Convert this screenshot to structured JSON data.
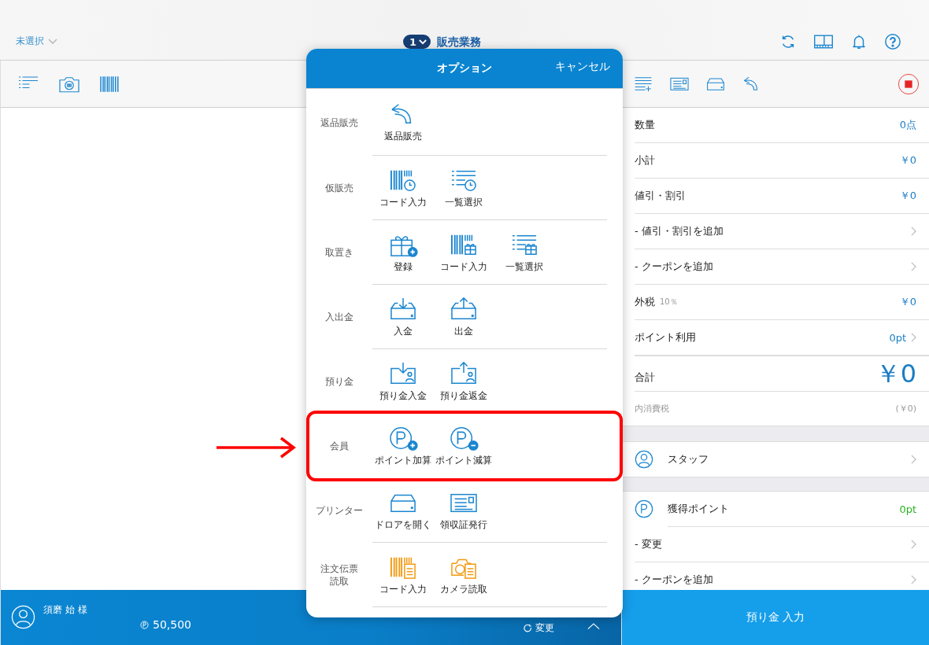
{
  "top_bar": {
    "store_select": "未選択",
    "register_number": "1",
    "title": "販売業務"
  },
  "customer_bar": {
    "name": "須磨 始 様",
    "points": "50,500",
    "change": "変更"
  },
  "options_dialog": {
    "title": "オプション",
    "cancel": "キャンセル",
    "sections": [
      {
        "label_lines": [
          "返品販売"
        ],
        "highlighted": false,
        "items": [
          "返品販売"
        ]
      },
      {
        "label_lines": [
          "仮販売"
        ],
        "highlighted": false,
        "items": [
          "コード入力",
          "一覧選択"
        ]
      },
      {
        "label_lines": [
          "取置き"
        ],
        "highlighted": false,
        "items": [
          "登録",
          "コード入力",
          "一覧選択"
        ]
      },
      {
        "label_lines": [
          "入出金"
        ],
        "highlighted": false,
        "items": [
          "入金",
          "出金"
        ]
      },
      {
        "label_lines": [
          "預り金"
        ],
        "highlighted": false,
        "items": [
          "預り金入金",
          "預り金返金"
        ]
      },
      {
        "label_lines": [
          "会員"
        ],
        "highlighted": true,
        "items": [
          "ポイント加算",
          "ポイント減算"
        ]
      },
      {
        "label_lines": [
          "プリンター"
        ],
        "highlighted": false,
        "items": [
          "ドロアを開く",
          "領収証発行"
        ]
      },
      {
        "label_lines": [
          "注文伝票",
          "読取"
        ],
        "highlighted": false,
        "items": [
          "コード入力",
          "カメラ読取"
        ]
      }
    ]
  },
  "summary": {
    "rows": [
      {
        "kind": "value",
        "label": "数量",
        "value": "0点"
      },
      {
        "kind": "value",
        "label": "小計",
        "value": "￥0"
      },
      {
        "kind": "value",
        "label": "値引・割引",
        "value": "￥0"
      },
      {
        "kind": "link",
        "label": "- 値引・割引を追加"
      },
      {
        "kind": "link",
        "label": "- クーポンを追加"
      },
      {
        "kind": "tax",
        "label": "外税",
        "note": "10％",
        "value": "￥0"
      },
      {
        "kind": "link",
        "label": "ポイント利用",
        "value": "0pt"
      }
    ],
    "total": {
      "label": "合計",
      "value": "￥0"
    },
    "tax_included": {
      "label": "内消費税",
      "value": "(￥0)"
    },
    "staff": "スタッフ",
    "earned_points": {
      "label": "獲得ポイント",
      "value": "0pt"
    },
    "point_rows": [
      "- 変更",
      "- クーポンを追加"
    ],
    "deposit_button": "預り金 入力"
  }
}
